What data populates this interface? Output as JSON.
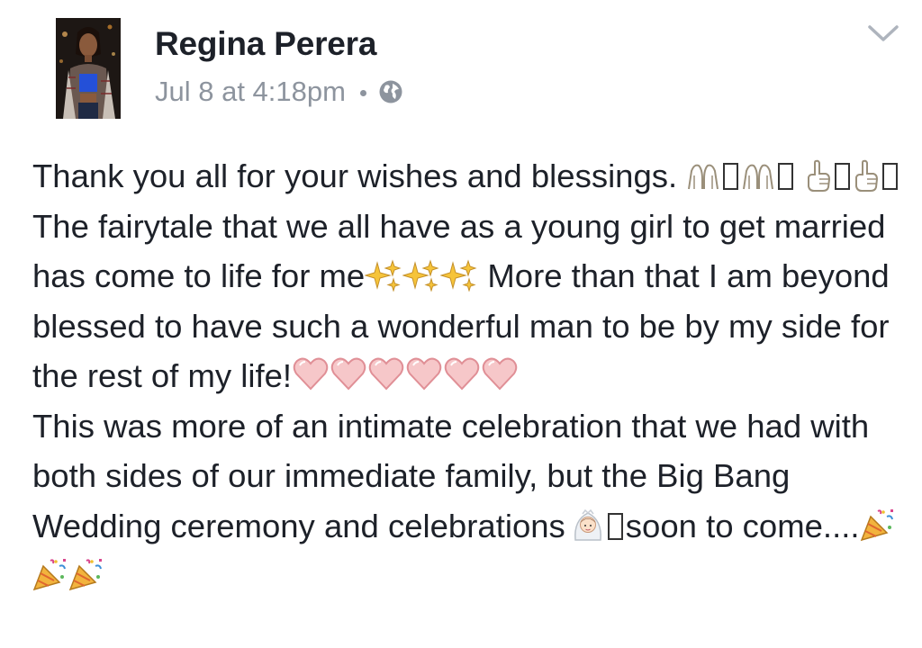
{
  "post": {
    "author_name": "Regina Perera",
    "timestamp": "Jul 8 at 4:18pm",
    "audience_icon": "globe-icon",
    "menu_icon": "chevron-down-icon",
    "paragraph1": {
      "text_1": "Thank you all for your wishes and blessings.",
      "text_2": "The fairytale that we all have as a young girl to get married has come to life for me",
      "text_3": " More than that I am beyond blessed to have such a wonderful man to be by my side for the rest of my life!"
    },
    "paragraph2": {
      "text_1": "This was more of an intimate celebration that we had with both sides of our immediate family, but the Big Bang Wedding ceremony and celebrations",
      "text_2": "soon to come...."
    },
    "emoji_names": [
      "pray-icon",
      "point-up-icon",
      "sparkles-icon",
      "heart-icon",
      "bride-icon",
      "party-popper-icon"
    ]
  },
  "colors": {
    "text": "#1d2129",
    "meta": "#8d949e",
    "heart": "#f0a3a8",
    "sparkle": "#f6c43a"
  }
}
